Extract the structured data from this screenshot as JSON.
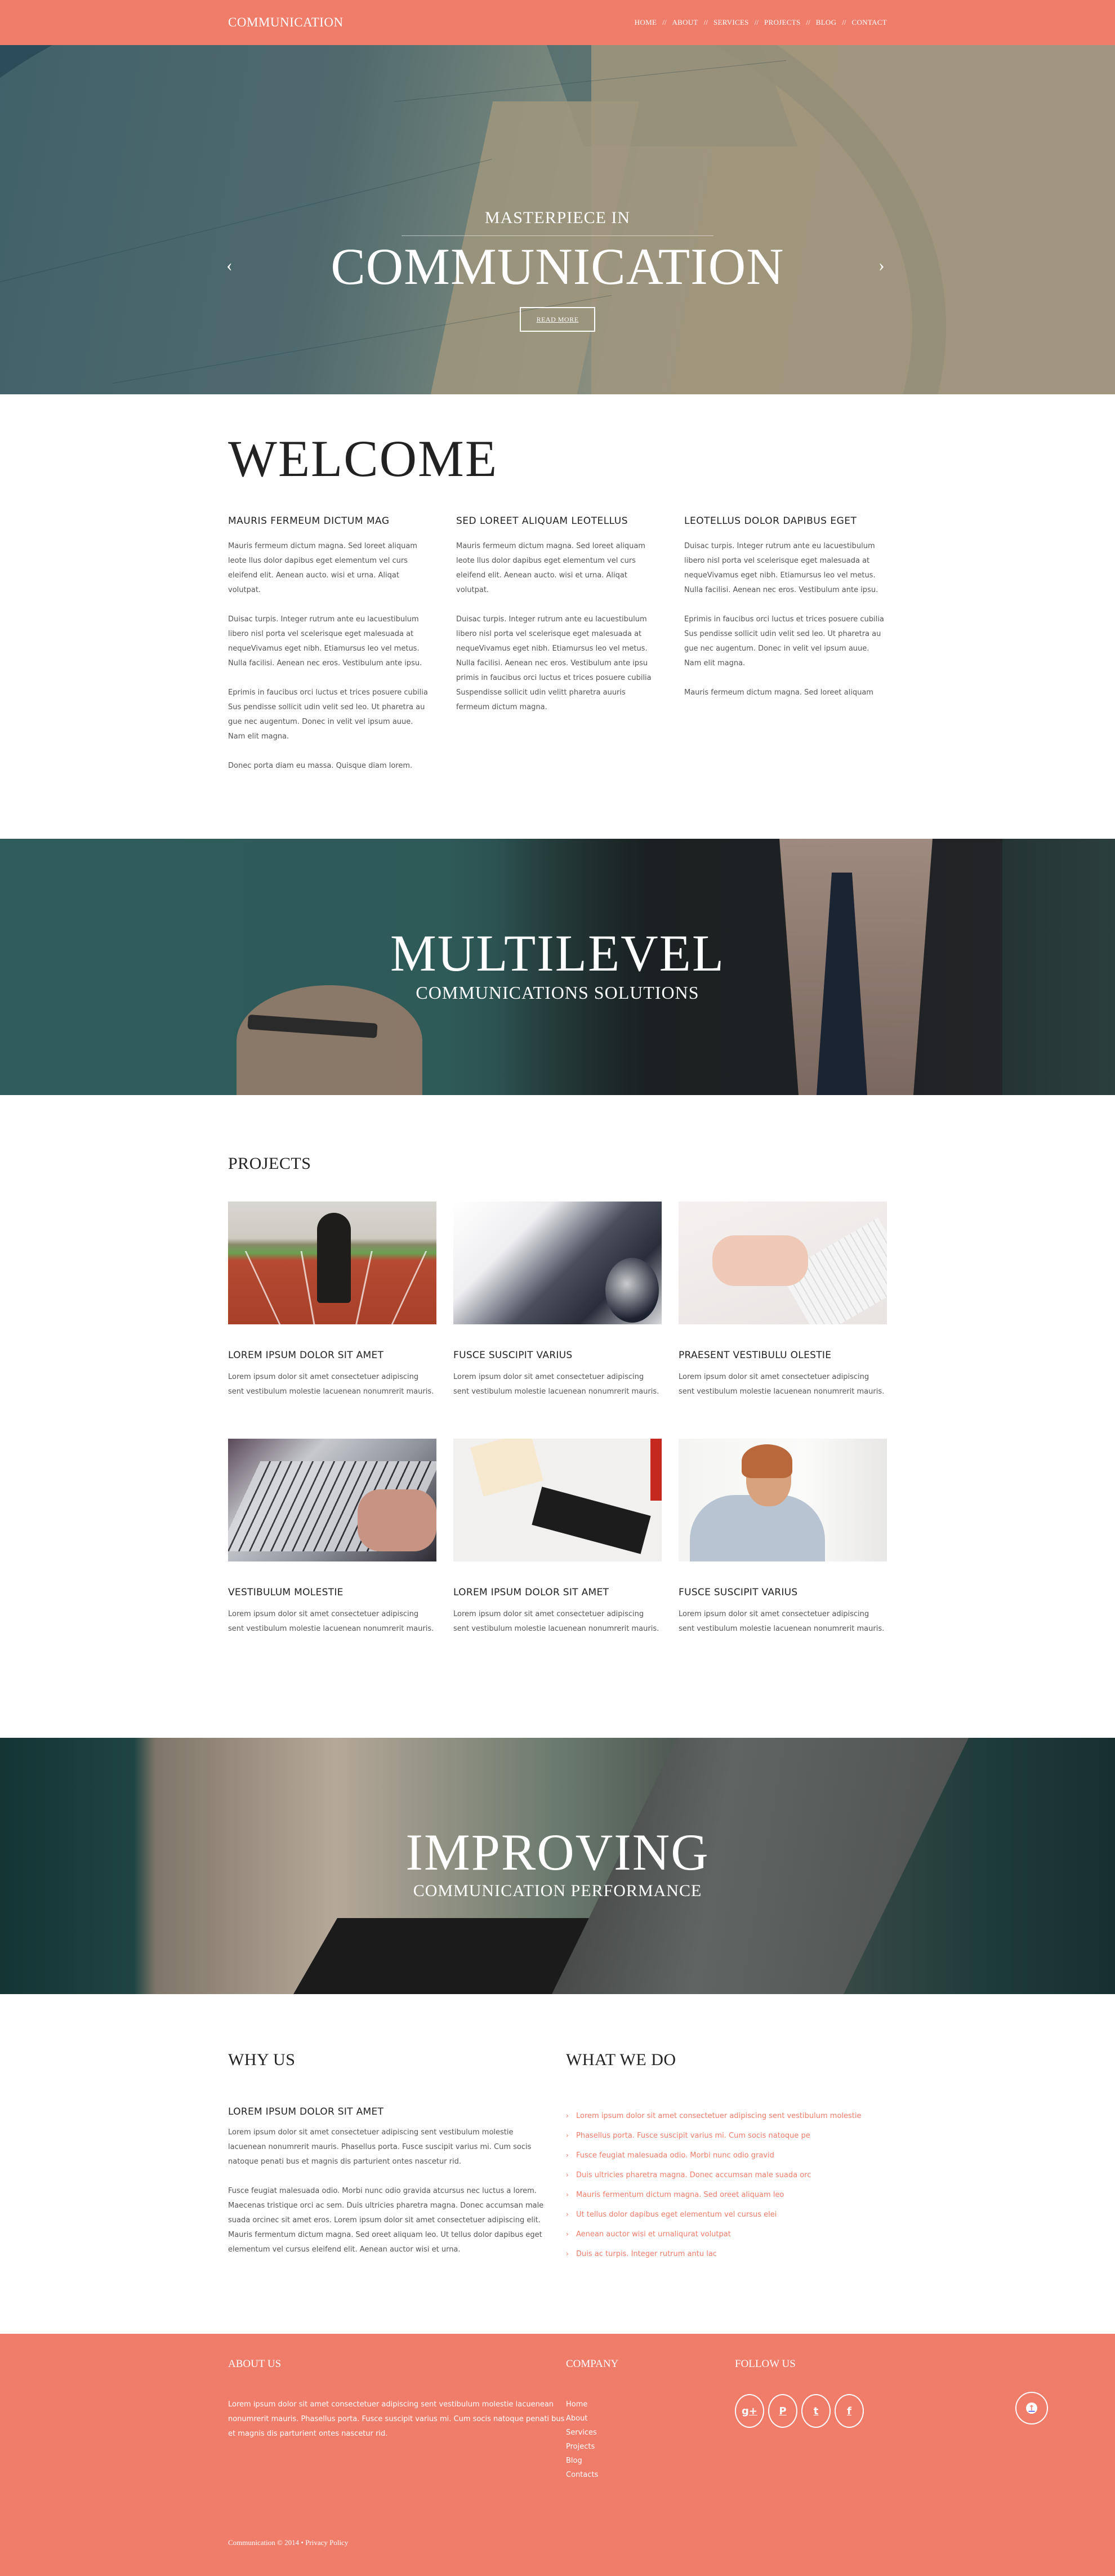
{
  "colors": {
    "accent": "#f07c6a",
    "heading": "#222222",
    "body_text": "#555555"
  },
  "header": {
    "logo": "COMMUNICATION",
    "nav": [
      {
        "label": "HOME"
      },
      {
        "label": "ABOUT"
      },
      {
        "label": "SERVICES"
      },
      {
        "label": "PROJECTS"
      },
      {
        "label": "BLOG"
      },
      {
        "label": "CONTACT"
      }
    ],
    "separator": "//"
  },
  "hero": {
    "pretitle": "MASTERPIECE IN",
    "title": "COMMUNICATION",
    "button": "READ MORE",
    "prev_icon": "chevron-left-icon",
    "next_icon": "chevron-right-icon",
    "prev_glyph": "‹",
    "next_glyph": "›"
  },
  "welcome": {
    "title": "WELCOME",
    "columns": [
      {
        "heading": "MAURIS FERMEUM DICTUM MAG",
        "paragraphs": [
          "Mauris fermeum dictum magna. Sed loreet aliquam leote llus dolor dapibus eget elementum vel curs eleifend elit. Aenean aucto. wisi et urna. Aliqat volutpat.",
          "Duisac turpis. Integer rutrum ante eu lacuestibulum libero nisl porta vel scelerisque eget malesuada at nequeVivamus eget nibh. Etiamursus leo vel metus. Nulla facilisi. Aenean nec eros. Vestibulum ante ipsu.",
          "Eprimis in faucibus orci luctus et trices posuere cubilia Sus pendisse sollicit udin velit sed leo. Ut pharetra au gue nec augentum. Donec in velit vel ipsum auue. Nam elit magna.",
          "Donec porta diam eu massa. Quisque diam lorem."
        ]
      },
      {
        "heading": "SED LOREET ALIQUAM LEOTELLUS",
        "paragraphs": [
          "Mauris fermeum dictum magna. Sed loreet aliquam leote llus dolor dapibus eget elementum vel curs eleifend elit. Aenean aucto. wisi et urna. Aliqat volutpat.",
          "Duisac turpis. Integer rutrum ante eu lacuestibulum libero nisl porta vel scelerisque eget malesuada at nequeVivamus eget nibh. Etiamursus leo vel metus. Nulla facilisi. Aenean nec eros. Vestibulum ante ipsu primis in faucibus orci luctus et trices posuere cubilia Suspendisse sollicit udin velitt pharetra auuris fermeum dictum magna."
        ]
      },
      {
        "heading": "LEOTELLUS DOLOR DAPIBUS EGET",
        "paragraphs": [
          "Duisac turpis. Integer rutrum ante eu lacuestibulum libero nisl porta vel scelerisque eget malesuada at nequeVivamus eget nibh. Etiamursus leo vel metus. Nulla facilisi. Aenean nec eros. Vestibulum ante ipsu.",
          "Eprimis in faucibus orci luctus et trices posuere cubilia Sus pendisse sollicit udin velit sed leo. Ut pharetra au gue nec augentum. Donec in velit vel ipsum auue. Nam elit magna.",
          "Mauris fermeum dictum magna. Sed loreet aliquam"
        ]
      }
    ]
  },
  "banner_multilevel": {
    "title": "MULTILEVEL",
    "subtitle": "COMMUNICATIONS SOLUTIONS"
  },
  "projects": {
    "title": "PROJECTS",
    "items": [
      {
        "image": "businessman-on-running-track",
        "heading": "LOREM IPSUM DOLOR SIT AMET",
        "text": "Lorem ipsum dolor sit amet consectetuer adipiscing sent vestibulum molestie lacuenean nonumrerit mauris."
      },
      {
        "image": "laptop-and-mouse",
        "heading": "FUSCE SUSCIPIT VARIUS",
        "text": "Lorem ipsum dolor sit amet consectetuer adipiscing sent vestibulum molestie lacuenean nonumrerit mauris."
      },
      {
        "image": "hands-typing-white-keyboard",
        "heading": "PRAESENT VESTIBULU OLESTIE",
        "text": "Lorem ipsum dolor sit amet consectetuer adipiscing sent vestibulum molestie lacuenean nonumrerit mauris."
      },
      {
        "image": "hands-on-laptop-keyboard",
        "heading": "VESTIBULUM MOLESTIE",
        "text": "Lorem ipsum dolor sit amet consectetuer adipiscing sent vestibulum molestie lacuenean nonumrerit mauris."
      },
      {
        "image": "desk-with-keyboard-and-charts",
        "heading": "LOREM IPSUM DOLOR SIT AMET",
        "text": "Lorem ipsum dolor sit amet consectetuer adipiscing sent vestibulum molestie lacuenean nonumrerit mauris."
      },
      {
        "image": "woman-with-glasses-and-pencil",
        "heading": "FUSCE SUSCIPIT VARIUS",
        "text": "Lorem ipsum dolor sit amet consectetuer adipiscing sent vestibulum molestie lacuenean nonumrerit mauris."
      }
    ]
  },
  "banner_improving": {
    "title": "IMPROVING",
    "subtitle": "COMMUNICATION PERFORMANCE"
  },
  "why_us": {
    "title": "WHY US",
    "heading": "LOREM IPSUM DOLOR SIT AMET",
    "paragraphs": [
      "Lorem ipsum dolor sit amet consectetuer adipiscing sent vestibulum molestie lacuenean nonumrerit mauris. Phasellus porta. Fusce suscipit varius mi. Cum socis natoque penati bus et magnis dis parturient ontes nascetur rid.",
      "Fusce feugiat malesuada odio. Morbi nunc odio gravida atcursus nec luctus a lorem. Maecenas tristique orci ac sem. Duis ultricies pharetra magna. Donec accumsan male suada orcinec sit amet eros. Lorem ipsum dolor sit amet consectetuer adipiscing elit. Mauris fermentum dictum magna. Sed oreet aliquam leo. Ut tellus dolor dapibus eget elementum vel cursus eleifend elit. Aenean auctor wisi et urna."
    ]
  },
  "what_we_do": {
    "title": "WHAT WE DO",
    "bullet_glyph": "›",
    "items": [
      "Lorem ipsum dolor sit amet consectetuer adipiscing sent vestibulum molestie",
      "Phasellus porta. Fusce suscipit varius mi. Cum socis natoque pe",
      "Fusce feugiat malesuada odio. Morbi nunc odio gravid",
      "Duis ultricies pharetra magna. Donec accumsan male suada orc",
      "Mauris fermentum dictum magna. Sed oreet aliquam leo",
      "Ut tellus dolor dapibus eget elementum vel cursus elei",
      "Aenean auctor wisi et urnaliqurat volutpat",
      "Duis ac turpis. Integer rutrum antu lac"
    ]
  },
  "footer": {
    "about": {
      "title": "ABOUT US",
      "text": "Lorem ipsum dolor sit amet consectetuer adipiscing sent vestibulum molestie lacuenean nonumrerit mauris. Phasellus porta. Fusce suscipit varius mi. Cum socis natoque penati bus et magnis dis parturient ontes nascetur rid."
    },
    "company": {
      "title": "COMPANY",
      "links": [
        "Home",
        "About",
        "Services",
        "Projects",
        "Blog",
        "Contacts"
      ]
    },
    "follow": {
      "title": "FOLLOW US",
      "socials": [
        {
          "name": "google-plus-icon",
          "glyph": "g+"
        },
        {
          "name": "pinterest-icon",
          "glyph": "P"
        },
        {
          "name": "twitter-icon",
          "glyph": "t"
        },
        {
          "name": "facebook-icon",
          "glyph": "f"
        }
      ]
    },
    "back_to_top_glyph": "↑",
    "copyright": "Communication © 2014 •",
    "privacy": "Privacy Policy"
  }
}
